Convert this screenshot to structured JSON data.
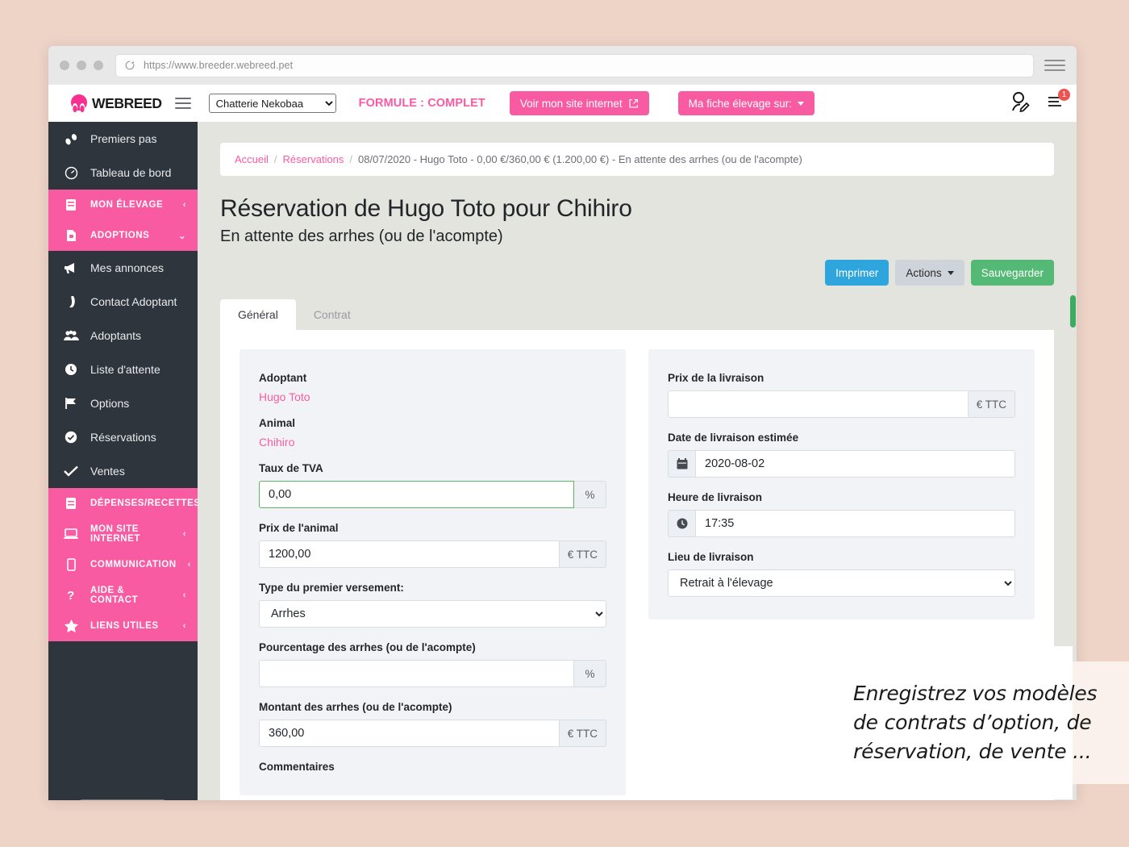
{
  "browser": {
    "url": "https://www.breeder.webreed.pet",
    "reload_icon": "reload-icon",
    "menu_icon": "browser-menu-icon"
  },
  "header": {
    "logo_text": "WEBREED",
    "logo_icon": "webreed-paw-logo",
    "menu_icon": "hamburger-icon",
    "org_select": {
      "value": "Chatterie Nekobaa",
      "options": [
        "Chatterie Nekobaa"
      ]
    },
    "formule": "FORMULE : COMPLET",
    "site_button": "Voir mon site internet",
    "site_button_icon": "external-link-icon",
    "fiche_button": "Ma fiche élevage sur:",
    "account_icon": "user-edit-icon",
    "notifications_icon": "notifications-list-icon",
    "notifications_count": "1"
  },
  "sidebar": {
    "items": [
      {
        "label": "Premiers pas",
        "icon": "footsteps-icon",
        "type": "item"
      },
      {
        "label": "Tableau de bord",
        "icon": "dashboard-gauge-icon",
        "type": "item"
      },
      {
        "label": "MON ÉLEVAGE",
        "icon": "book-icon",
        "type": "group",
        "chevron": "‹"
      },
      {
        "label": "ADOPTIONS",
        "icon": "file-lock-icon",
        "type": "group",
        "chevron": "⌄"
      },
      {
        "label": "Mes annonces",
        "icon": "megaphone-icon",
        "type": "item"
      },
      {
        "label": "Contact Adoptant",
        "icon": "phone-icon",
        "type": "item"
      },
      {
        "label": "Adoptants",
        "icon": "users-icon",
        "type": "item"
      },
      {
        "label": "Liste d'attente",
        "icon": "clock-icon",
        "type": "item"
      },
      {
        "label": "Options",
        "icon": "flag-icon",
        "type": "item"
      },
      {
        "label": "Réservations",
        "icon": "check-circle-icon",
        "type": "item"
      },
      {
        "label": "Ventes",
        "icon": "check-icon",
        "type": "item"
      },
      {
        "label": "DÉPENSES/RECETTES",
        "icon": "ledger-icon",
        "type": "group",
        "chevron": "‹"
      },
      {
        "label": "MON SITE INTERNET",
        "icon": "laptop-icon",
        "type": "group",
        "chevron": "‹"
      },
      {
        "label": "COMMUNICATION",
        "icon": "mobile-icon",
        "type": "group",
        "chevron": "‹"
      },
      {
        "label": "AIDE & CONTACT",
        "icon": "question-mark-icon",
        "type": "group",
        "chevron": "‹"
      },
      {
        "label": "LIENS UTILES",
        "icon": "star-icon",
        "type": "group",
        "chevron": "‹"
      }
    ]
  },
  "breadcrumb": {
    "home": "Accueil",
    "section": "Réservations",
    "current": "08/07/2020 - Hugo Toto - 0,00 €/360,00 € (1.200,00 €) - En attente des arrhes (ou de l'acompte)",
    "separator": "/"
  },
  "page": {
    "title": "Réservation de Hugo Toto pour Chihiro",
    "subtitle": "En attente des arrhes (ou de l'acompte)"
  },
  "actions": {
    "print": "Imprimer",
    "actions": "Actions",
    "save": "Sauvegarder"
  },
  "tabs": [
    {
      "label": "Général",
      "active": true
    },
    {
      "label": "Contrat",
      "active": false
    }
  ],
  "form_left": {
    "adoptant_label": "Adoptant",
    "adoptant_value": "Hugo Toto",
    "animal_label": "Animal",
    "animal_value": "Chihiro",
    "tva_label": "Taux de TVA",
    "tva_value": "0,00",
    "tva_addon": "%",
    "prix_label": "Prix de l'animal",
    "prix_value": "1200,00",
    "prix_addon": "€ TTC",
    "versement_label": "Type du premier versement:",
    "versement_value": "Arrhes",
    "versement_options": [
      "Arrhes"
    ],
    "pourcentage_label": "Pourcentage des arrhes (ou de l'acompte)",
    "pourcentage_value": "",
    "pourcentage_addon": "%",
    "montant_label": "Montant des arrhes (ou de l'acompte)",
    "montant_value": "360,00",
    "montant_addon": "€ TTC",
    "commentaires_label": "Commentaires"
  },
  "form_right": {
    "prix_livraison_label": "Prix de la livraison",
    "prix_livraison_value": "",
    "prix_livraison_addon": "€ TTC",
    "date_label": "Date de livraison estimée",
    "date_value": "2020-08-02",
    "date_icon": "calendar-icon",
    "heure_label": "Heure de livraison",
    "heure_value": "17:35",
    "heure_icon": "clock-icon",
    "lieu_label": "Lieu de livraison",
    "lieu_value": "Retrait à l'élevage",
    "lieu_options": [
      "Retrait à l'élevage"
    ]
  },
  "caption": {
    "text": "Enregistrez vos modèles de contrats d’option, de réservation, de vente ..."
  },
  "colors": {
    "brand_pink": "#f95ba2",
    "sidebar_dark": "#2f353d",
    "print_blue": "#2ea6dd",
    "save_green": "#54b974",
    "page_bg": "#eed4c7",
    "badge_red": "#ef5350"
  }
}
